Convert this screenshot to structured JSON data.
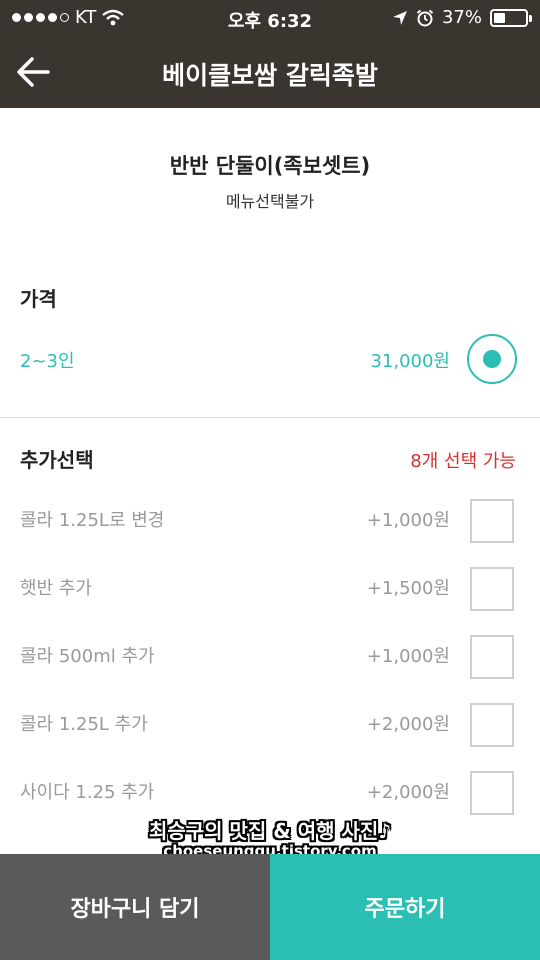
{
  "status_bar": {
    "carrier": "KT",
    "time": "오후 6:32",
    "battery": "37%",
    "battery_level": 0.37,
    "signal_bars_filled": 4,
    "signal_bars_total": 5
  },
  "nav": {
    "title": "베이클보쌈 갈릭족발",
    "back_icon": "back-arrow-icon"
  },
  "menu": {
    "name": "반반 단둘이(족보셋트)",
    "subtitle": "메뉴선택불가"
  },
  "price_section": {
    "title": "가격",
    "option_label": "2~3인",
    "option_price": "31,000원",
    "selected": true
  },
  "extra_section": {
    "title": "추가선택",
    "availability": "8개 선택 가능",
    "options": [
      {
        "label": "콜라 1.25L로 변경",
        "price": "+1,000원",
        "checked": false
      },
      {
        "label": "햇반 추가",
        "price": "+1,500원",
        "checked": false
      },
      {
        "label": "콜라 500ml 추가",
        "price": "+1,000원",
        "checked": false
      },
      {
        "label": "콜라 1.25L 추가",
        "price": "+2,000원",
        "checked": false
      },
      {
        "label": "사이다 1.25 추가",
        "price": "+2,000원",
        "checked": false
      }
    ]
  },
  "watermark": {
    "line1": "최승구의 맛집 & 여행 사진♪",
    "line2": "choeseunggu.tistory.com"
  },
  "actions": {
    "cart_label": "장바구니 담기",
    "order_label": "주문하기"
  },
  "colors": {
    "header_bg": "#3b3530",
    "accent": "#2bbfb3",
    "warning": "#d9302f",
    "cart_bg": "#5a5a5a"
  }
}
